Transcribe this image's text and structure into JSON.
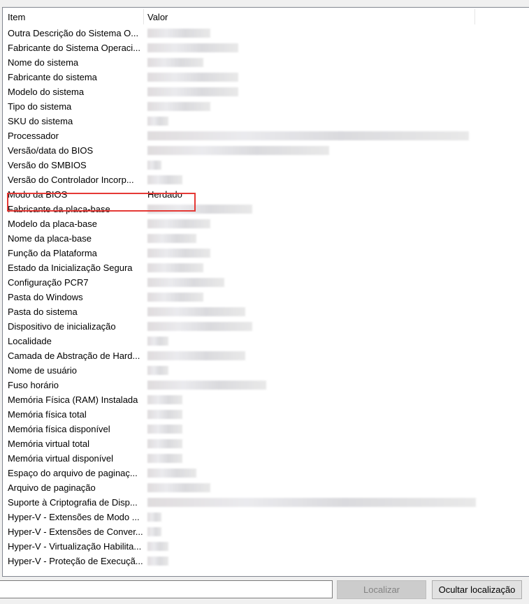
{
  "columns": {
    "item": "Item",
    "value": "Valor"
  },
  "rows": [
    {
      "item": "Outra Descrição do Sistema O...",
      "value": null
    },
    {
      "item": "Fabricante do Sistema Operaci...",
      "value": null
    },
    {
      "item": "Nome do sistema",
      "value": null
    },
    {
      "item": "Fabricante do sistema",
      "value": null
    },
    {
      "item": "Modelo do sistema",
      "value": null
    },
    {
      "item": "Tipo do sistema",
      "value": null
    },
    {
      "item": "SKU do sistema",
      "value": null
    },
    {
      "item": "Processador",
      "value": null
    },
    {
      "item": "Versão/data do BIOS",
      "value": null
    },
    {
      "item": "Versão do SMBIOS",
      "value": null
    },
    {
      "item": "Versão do Controlador Incorp...",
      "value": null
    },
    {
      "item": "Modo da BIOS",
      "value": "Herdado",
      "highlighted": true
    },
    {
      "item": "Fabricante da placa-base",
      "value": null
    },
    {
      "item": "Modelo da placa-base",
      "value": null
    },
    {
      "item": "Nome da placa-base",
      "value": null
    },
    {
      "item": "Função da Plataforma",
      "value": null
    },
    {
      "item": "Estado da Inicialização Segura",
      "value": null
    },
    {
      "item": "Configuração PCR7",
      "value": null
    },
    {
      "item": "Pasta do Windows",
      "value": null
    },
    {
      "item": "Pasta do sistema",
      "value": null
    },
    {
      "item": "Dispositivo de inicialização",
      "value": null
    },
    {
      "item": "Localidade",
      "value": null
    },
    {
      "item": "Camada de Abstração de Hard...",
      "value": null
    },
    {
      "item": "Nome de usuário",
      "value": null
    },
    {
      "item": "Fuso horário",
      "value": null
    },
    {
      "item": "Memória Física (RAM) Instalada",
      "value": null
    },
    {
      "item": "Memória física total",
      "value": null
    },
    {
      "item": "Memória física disponível",
      "value": null
    },
    {
      "item": "Memória virtual total",
      "value": null
    },
    {
      "item": "Memória virtual disponível",
      "value": null
    },
    {
      "item": "Espaço do arquivo de paginaç...",
      "value": null
    },
    {
      "item": "Arquivo de paginação",
      "value": null
    },
    {
      "item": "Suporte à Criptografia de Disp...",
      "value": null
    },
    {
      "item": "Hyper-V - Extensões de Modo ...",
      "value": null
    },
    {
      "item": "Hyper-V - Extensões de Conver...",
      "value": null
    },
    {
      "item": "Hyper-V - Virtualização Habilita...",
      "value": null
    },
    {
      "item": "Hyper-V - Proteção de Execuçã...",
      "value": null
    }
  ],
  "search": {
    "value": ""
  },
  "buttons": {
    "find": "Localizar",
    "hide_find": "Ocultar localização"
  },
  "colors": {
    "highlight": "#e53935"
  }
}
